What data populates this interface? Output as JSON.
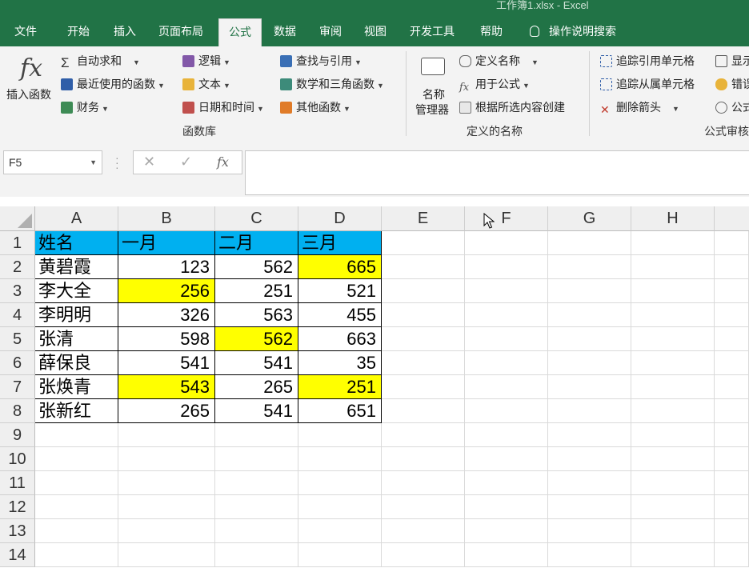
{
  "title": "工作簿1.xlsx - Excel",
  "menu": [
    "文件",
    "开始",
    "插入",
    "页面布局",
    "公式",
    "数据",
    "审阅",
    "视图",
    "开发工具",
    "帮助",
    "操作说明搜索"
  ],
  "active_tab": "公式",
  "ribbon": {
    "insert_function": "插入函数",
    "library": {
      "autosum": "自动求和",
      "recent": "最近使用的函数",
      "finance": "财务",
      "logic": "逻辑",
      "text": "文本",
      "datetime": "日期和时间",
      "lookup": "查找与引用",
      "math": "数学和三角函数",
      "more": "其他函数",
      "label": "函数库"
    },
    "names": {
      "manager_line1": "名称",
      "manager_line2": "管理器",
      "define": "定义名称",
      "use": "用于公式",
      "create": "根据所选内容创建",
      "label": "定义的名称"
    },
    "audit": {
      "precedents": "追踪引用单元格",
      "dependents": "追踪从属单元格",
      "remove": "删除箭头",
      "show": "显示",
      "error": "错误",
      "evaluate": "公式",
      "label": "公式审核"
    }
  },
  "name_box": "F5",
  "formula_value": "",
  "columns": [
    "A",
    "B",
    "C",
    "D",
    "E",
    "F",
    "G",
    "H"
  ],
  "rows": [
    "1",
    "2",
    "3",
    "4",
    "5",
    "6",
    "7",
    "8",
    "9",
    "10",
    "11",
    "12",
    "13",
    "14"
  ],
  "table": [
    [
      "姓名",
      "一月",
      "二月",
      "三月"
    ],
    [
      "黄碧霞",
      "123",
      "562",
      "665"
    ],
    [
      "李大全",
      "256",
      "251",
      "521"
    ],
    [
      "李明明",
      "326",
      "563",
      "455"
    ],
    [
      "张清",
      "598",
      "562",
      "663"
    ],
    [
      "薛保良",
      "541",
      "541",
      "35"
    ],
    [
      "张焕青",
      "543",
      "265",
      "251"
    ],
    [
      "张新红",
      "265",
      "541",
      "651"
    ]
  ],
  "highlighted_cells": [
    "D2",
    "B3",
    "C5",
    "B7",
    "D7"
  ],
  "colors": {
    "accent": "#217346",
    "header_fill": "#00b0f0",
    "highlight": "#ffff00"
  }
}
